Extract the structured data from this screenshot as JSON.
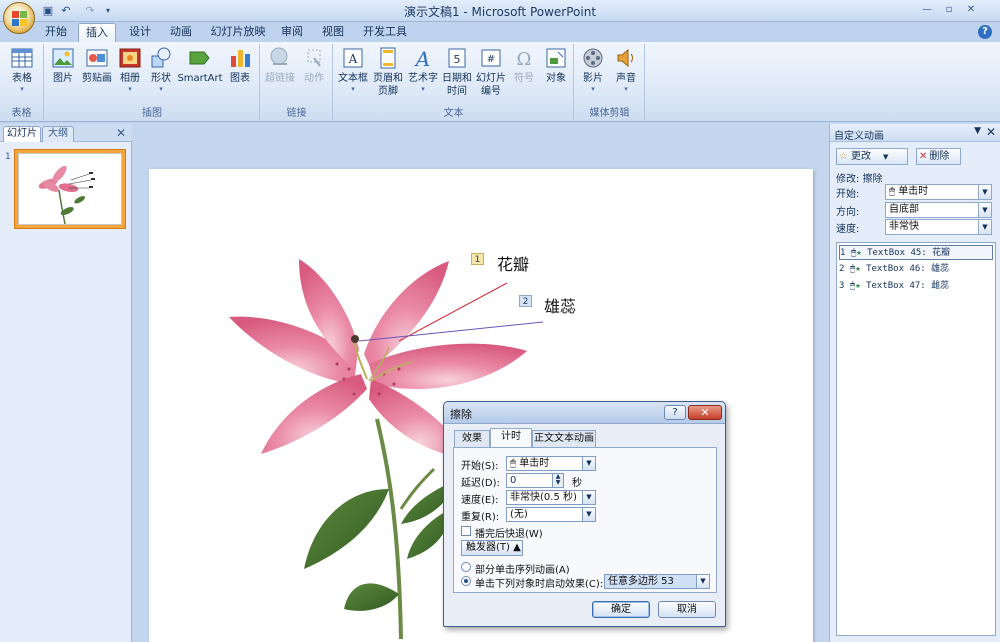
{
  "window": {
    "title": "演示文稿1 - Microsoft PowerPoint",
    "qat_undo": "↶",
    "qat_redo": "↷",
    "qat_save": "▣",
    "minimize": "—",
    "restore": "▫",
    "close": "✕",
    "help": "?"
  },
  "ribbon": {
    "tabs": [
      "开始",
      "插入",
      "设计",
      "动画",
      "幻灯片放映",
      "审阅",
      "视图",
      "开发工具"
    ],
    "active_tab": "插入",
    "groups": [
      {
        "label": "表格",
        "buttons": [
          {
            "label": "表格",
            "icon": "table-icon"
          }
        ]
      },
      {
        "label": "插图",
        "buttons": [
          {
            "label": "图片",
            "icon": "picture-icon"
          },
          {
            "label": "剪贴画",
            "icon": "clipart-icon"
          },
          {
            "label": "相册",
            "icon": "photo-album-icon"
          },
          {
            "label": "形状",
            "icon": "shapes-icon"
          },
          {
            "label": "SmartArt",
            "icon": "smartart-icon"
          },
          {
            "label": "图表",
            "icon": "chart-icon"
          }
        ]
      },
      {
        "label": "链接",
        "buttons": [
          {
            "label": "超链接",
            "icon": "hyperlink-icon"
          },
          {
            "label": "动作",
            "icon": "action-icon"
          }
        ]
      },
      {
        "label": "文本",
        "buttons": [
          {
            "label": "文本框",
            "icon": "textbox-icon"
          },
          {
            "label": "页眉和",
            "label2": "页脚",
            "icon": "header-footer-icon"
          },
          {
            "label": "艺术字",
            "icon": "wordart-icon"
          },
          {
            "label": "日期和",
            "label2": "时间",
            "icon": "date-time-icon"
          },
          {
            "label": "幻灯片",
            "label2": "编号",
            "icon": "slide-number-icon"
          },
          {
            "label": "符号",
            "icon": "symbol-icon"
          },
          {
            "label": "对象",
            "icon": "object-icon"
          }
        ]
      },
      {
        "label": "媒体剪辑",
        "buttons": [
          {
            "label": "影片",
            "icon": "movie-icon"
          },
          {
            "label": "声音",
            "icon": "sound-icon"
          }
        ]
      }
    ]
  },
  "left_pane": {
    "tabs": [
      "幻灯片",
      "大纲"
    ],
    "close": "✕",
    "slide_number": "1"
  },
  "slide": {
    "labels": [
      {
        "tag": "1",
        "text": "花瓣"
      },
      {
        "tag": "2",
        "text": "雄蕊"
      }
    ]
  },
  "right_pane": {
    "title": "自定义动画",
    "menu_arrow": "▼",
    "close": "✕",
    "change_button": "更改",
    "delete_button": "删除",
    "modify_text": "修改: 擦除",
    "start_label": "开始:",
    "start_value": "单击时",
    "direction_label": "方向:",
    "direction_value": "自底部",
    "speed_label": "速度:",
    "speed_value": "非常快",
    "items": [
      {
        "num": "1",
        "text": "TextBox 45: 花瓣"
      },
      {
        "num": "2",
        "text": "TextBox 46: 雄蕊"
      },
      {
        "num": "3",
        "text": "TextBox 47: 雌蕊"
      }
    ]
  },
  "dialog": {
    "title": "擦除",
    "help": "?",
    "close": "✕",
    "tabs": [
      "效果",
      "计时",
      "正文文本动画"
    ],
    "active_tab": "计时",
    "start_label": "开始(S):",
    "start_value": "单击时",
    "delay_label": "延迟(D):",
    "delay_value": "0",
    "delay_unit": "秒",
    "speed_label": "速度(E):",
    "speed_value": "非常快(0.5 秒)",
    "repeat_label": "重复(R):",
    "repeat_value": "(无)",
    "rewind_label": "播完后快退(W)",
    "trigger_button": "触发器(T) ▲",
    "radio_sequence_label": "部分单击序列动画(A)",
    "radio_object_label": "单击下列对象时启动效果(C):",
    "object_value": "任意多边形 53",
    "ok_button": "确定",
    "cancel_button": "取消"
  },
  "colors": {
    "accent": "#2f6fc1",
    "ribbon_bg": "#dde8f7",
    "slide_thumb_selected": "#f6a53d",
    "line_petal": "#d0303a",
    "line_stamen": "#6a55b8"
  }
}
